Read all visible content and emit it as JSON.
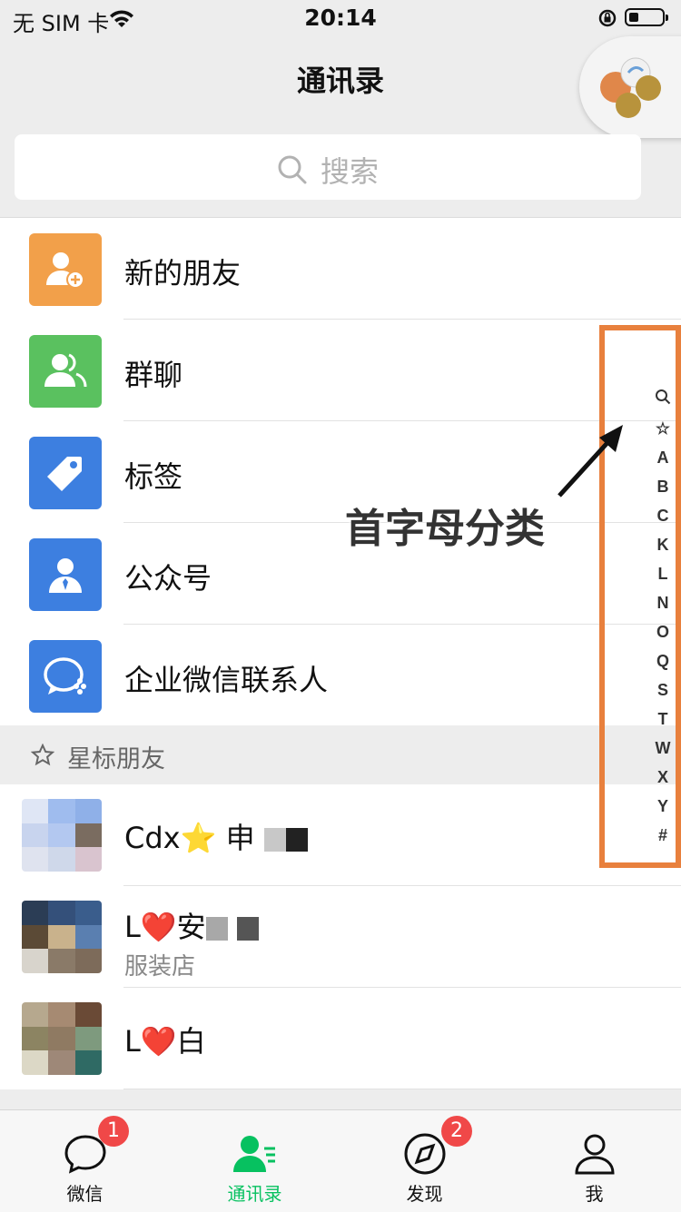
{
  "status": {
    "carrier": "无 SIM 卡",
    "time": "20:14"
  },
  "nav": {
    "title": "通讯录"
  },
  "search": {
    "placeholder": "搜索"
  },
  "menu": [
    {
      "label": "新的朋友",
      "icon": "add-friend-icon",
      "color": "#f2a04a"
    },
    {
      "label": "群聊",
      "icon": "group-chat-icon",
      "color": "#5ac15f"
    },
    {
      "label": "标签",
      "icon": "tag-icon",
      "color": "#3d7fe0"
    },
    {
      "label": "公众号",
      "icon": "official-account-icon",
      "color": "#3d7fe0"
    },
    {
      "label": "企业微信联系人",
      "icon": "work-wechat-icon",
      "color": "#3d7fe0"
    }
  ],
  "starred": {
    "label": "星标朋友"
  },
  "contacts": [
    {
      "name": "Cdx⭐️ 申",
      "sub": ""
    },
    {
      "name": "L❤️安",
      "sub": "服装店"
    },
    {
      "name": "L❤️白",
      "sub": ""
    }
  ],
  "index": [
    "☆",
    "A",
    "B",
    "C",
    "K",
    "L",
    "N",
    "O",
    "Q",
    "S",
    "T",
    "W",
    "X",
    "Y",
    "#"
  ],
  "annotation": "首字母分类",
  "tabs": [
    {
      "label": "微信",
      "badge": "1"
    },
    {
      "label": "通讯录",
      "badge": ""
    },
    {
      "label": "发现",
      "badge": "2"
    },
    {
      "label": "我",
      "badge": ""
    }
  ],
  "colors": {
    "accent": "#07c160",
    "badge": "#f04848",
    "highlight": "#e8803d"
  }
}
